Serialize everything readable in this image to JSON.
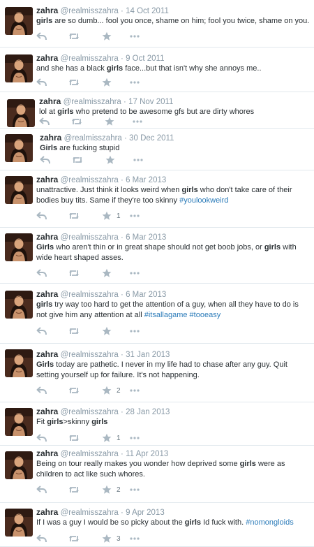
{
  "colors": {
    "icon": "#aab8c2",
    "text": "#292f33",
    "meta": "#8899a6",
    "hashtag": "#2b7bb9",
    "divider": "#e1e8ed"
  },
  "icons": {
    "avatar": "profile-photo",
    "reply": "reply-arrow",
    "retweet": "retweet-arrows",
    "favorite": "star",
    "more": "ellipsis"
  },
  "tweets": [
    {
      "name": "zahra",
      "handle": "@realmisszahra",
      "sep": "·",
      "date": "14 Oct 2011",
      "segments": [
        {
          "t": "girls",
          "b": true
        },
        {
          "t": " are so dumb... fool you once, shame on him; fool you twice, shame on you."
        }
      ],
      "favorites": "",
      "retweets": ""
    },
    {
      "name": "zahra",
      "handle": "@realmisszahra",
      "sep": "·",
      "date": "9 Oct 2011",
      "segments": [
        {
          "t": "and she has a black "
        },
        {
          "t": "girls",
          "b": true
        },
        {
          "t": " face...but that isn't why she annoys me.."
        }
      ],
      "favorites": "",
      "retweets": ""
    },
    {
      "name": "zahra",
      "handle": "@realmisszahra",
      "sep": "·",
      "date": "17 Nov 2011",
      "segments": [
        {
          "t": "lol at "
        },
        {
          "t": "girls",
          "b": true
        },
        {
          "t": " who pretend to be awesome gfs but are dirty whores"
        }
      ],
      "favorites": "",
      "retweets": ""
    },
    {
      "name": "zahra",
      "handle": "@realmisszahra",
      "sep": "·",
      "date": "30 Dec 2011",
      "segments": [
        {
          "t": "Girls",
          "b": true
        },
        {
          "t": " are fucking stupid"
        }
      ],
      "favorites": "",
      "retweets": ""
    },
    {
      "name": "zahra",
      "handle": "@realmisszahra",
      "sep": "·",
      "date": "6 Mar 2013",
      "segments": [
        {
          "t": "unattractive. Just think it looks weird when "
        },
        {
          "t": "girls",
          "b": true
        },
        {
          "t": " who don't take care of their bodies buy tits.  Same if they're too skinny "
        },
        {
          "t": "#youlookweird",
          "h": true
        }
      ],
      "favorites": "1",
      "retweets": ""
    },
    {
      "name": "zahra",
      "handle": "@realmisszahra",
      "sep": "·",
      "date": "6 Mar 2013",
      "segments": [
        {
          "t": "Girls",
          "b": true
        },
        {
          "t": " who aren't thin or in great shape should not get boob jobs, or "
        },
        {
          "t": "girls",
          "b": true
        },
        {
          "t": " with wide heart shaped asses."
        }
      ],
      "favorites": "",
      "retweets": ""
    },
    {
      "name": "zahra",
      "handle": "@realmisszahra",
      "sep": "·",
      "date": "6 Mar 2013",
      "segments": [
        {
          "t": "girls",
          "b": true
        },
        {
          "t": " try way too hard to get the attention of a guy, when all they have to do is not give him any attention at all "
        },
        {
          "t": "#itsallagame",
          "h": true
        },
        {
          "t": " "
        },
        {
          "t": "#tooeasy",
          "h": true
        }
      ],
      "favorites": "",
      "retweets": ""
    },
    {
      "name": "zahra",
      "handle": "@realmisszahra",
      "sep": "·",
      "date": "31 Jan 2013",
      "segments": [
        {
          "t": "Girls",
          "b": true
        },
        {
          "t": " today are pathetic. I never in my life had to chase after any guy. Quit setting yourself up for failure. It's not happening."
        }
      ],
      "favorites": "2",
      "retweets": ""
    },
    {
      "name": "zahra",
      "handle": "@realmisszahra",
      "sep": "·",
      "date": "28 Jan 2013",
      "segments": [
        {
          "t": "Fit "
        },
        {
          "t": "girls",
          "b": true
        },
        {
          "t": ">skinny "
        },
        {
          "t": "girls",
          "b": true
        }
      ],
      "favorites": "1",
      "retweets": ""
    },
    {
      "name": "zahra",
      "handle": "@realmisszahra",
      "sep": "·",
      "date": "11 Apr 2013",
      "segments": [
        {
          "t": "Being on tour really makes you wonder how deprived some "
        },
        {
          "t": "girls",
          "b": true
        },
        {
          "t": " were as children to act like such whores."
        }
      ],
      "favorites": "2",
      "retweets": ""
    },
    {
      "name": "zahra",
      "handle": "@realmisszahra",
      "sep": "·",
      "date": "9 Apr 2013",
      "segments": [
        {
          "t": "If I was a guy I would be so picky about the "
        },
        {
          "t": "girls",
          "b": true
        },
        {
          "t": " Id fuck with. "
        },
        {
          "t": "#nomongloids",
          "h": true
        }
      ],
      "favorites": "3",
      "retweets": ""
    }
  ]
}
